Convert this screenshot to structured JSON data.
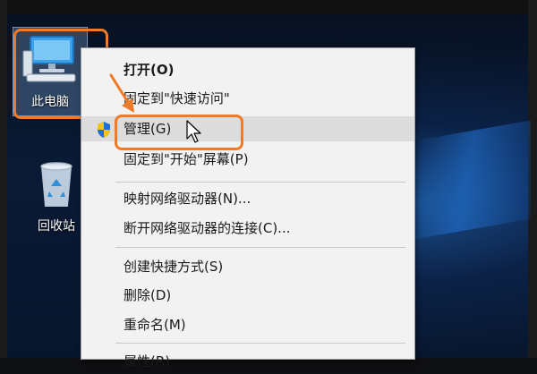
{
  "desktop": {
    "this_pc_label": "此电脑",
    "recycle_label": "回收站"
  },
  "menu": {
    "items": [
      {
        "label": "打开(O)"
      },
      {
        "label": "固定到\"快速访问\""
      },
      {
        "label": "管理(G)"
      },
      {
        "label": "固定到\"开始\"屏幕(P)"
      },
      {
        "label": "映射网络驱动器(N)..."
      },
      {
        "label": "断开网络驱动器的连接(C)..."
      },
      {
        "label": "创建快捷方式(S)"
      },
      {
        "label": "删除(D)"
      },
      {
        "label": "重命名(M)"
      },
      {
        "label": "属性(R)"
      }
    ]
  },
  "colors": {
    "annotation": "#f07a28",
    "menu_bg": "#f2f2f2",
    "hover_bg": "#dcdcdc"
  }
}
